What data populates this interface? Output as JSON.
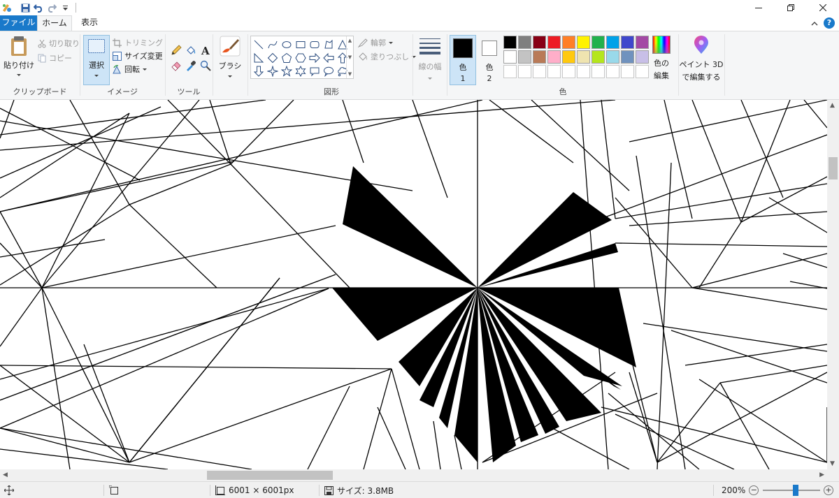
{
  "titlebar": {
    "qat_icons": [
      "paint-app-icon",
      "save-icon",
      "undo-icon",
      "redo-icon",
      "customize-qat-icon"
    ]
  },
  "menu": {
    "file": "ファイル",
    "home": "ホーム",
    "view": "表示"
  },
  "ribbon": {
    "clipboard": {
      "paste": "貼り付け",
      "cut": "切り取り",
      "copy": "コピー",
      "group_label": "クリップボード"
    },
    "image": {
      "select": "選択",
      "crop": "トリミング",
      "resize": "サイズ変更",
      "rotate": "回転",
      "group_label": "イメージ"
    },
    "tools": {
      "group_label": "ツール",
      "icons": [
        "pencil-icon",
        "fill-icon",
        "text-icon",
        "eraser-icon",
        "color-picker-icon",
        "magnifier-icon"
      ]
    },
    "brushes": {
      "label": "ブラシ"
    },
    "shapes": {
      "outline": "輪郭",
      "fill": "塗りつぶし",
      "group_label": "図形",
      "items": [
        "line-shape-icon",
        "curve-shape-icon",
        "oval-shape-icon",
        "rectangle-shape-icon",
        "rounded-rectangle-shape-icon",
        "polygon-shape-icon",
        "triangle-shape-icon",
        "right-triangle-shape-icon",
        "diamond-shape-icon",
        "pentagon-shape-icon",
        "hexagon-shape-icon",
        "right-arrow-shape-icon",
        "left-arrow-shape-icon",
        "up-arrow-shape-icon",
        "down-arrow-shape-icon",
        "four-point-star-shape-icon",
        "five-point-star-shape-icon",
        "six-point-star-shape-icon",
        "rounded-callout-shape-icon",
        "oval-callout-shape-icon",
        "cloud-callout-shape-icon"
      ]
    },
    "size": {
      "label": "線の幅"
    },
    "colors": {
      "color1_line1": "色",
      "color1_line2": "1",
      "color2_line1": "色",
      "color2_line2": "2",
      "color1_value": "#000000",
      "color2_value": "#ffffff",
      "edit_line1": "色の",
      "edit_line2": "編集",
      "group_label": "色",
      "palette_row1": [
        "#000000",
        "#7f7f7f",
        "#880015",
        "#ed1c24",
        "#ff7f27",
        "#fff200",
        "#22b14c",
        "#00a2e8",
        "#3f48cc",
        "#a349a4"
      ],
      "palette_row2": [
        "#ffffff",
        "#c3c3c3",
        "#b97a57",
        "#ffaec9",
        "#ffc90e",
        "#efe4b0",
        "#b5e61d",
        "#99d9ea",
        "#7092be",
        "#c8bfe7"
      ],
      "palette_row3": [
        "#ffffff",
        "#ffffff",
        "#ffffff",
        "#ffffff",
        "#ffffff",
        "#ffffff",
        "#ffffff",
        "#ffffff",
        "#ffffff",
        "#ffffff"
      ]
    },
    "paint3d": {
      "line1": "ペイント 3D",
      "line2": "で編集する"
    }
  },
  "status": {
    "dimensions": "6001 × 6001px",
    "size": "サイズ: 3.8MB",
    "zoom": "200%",
    "zoom_level_fraction": 0.57
  }
}
